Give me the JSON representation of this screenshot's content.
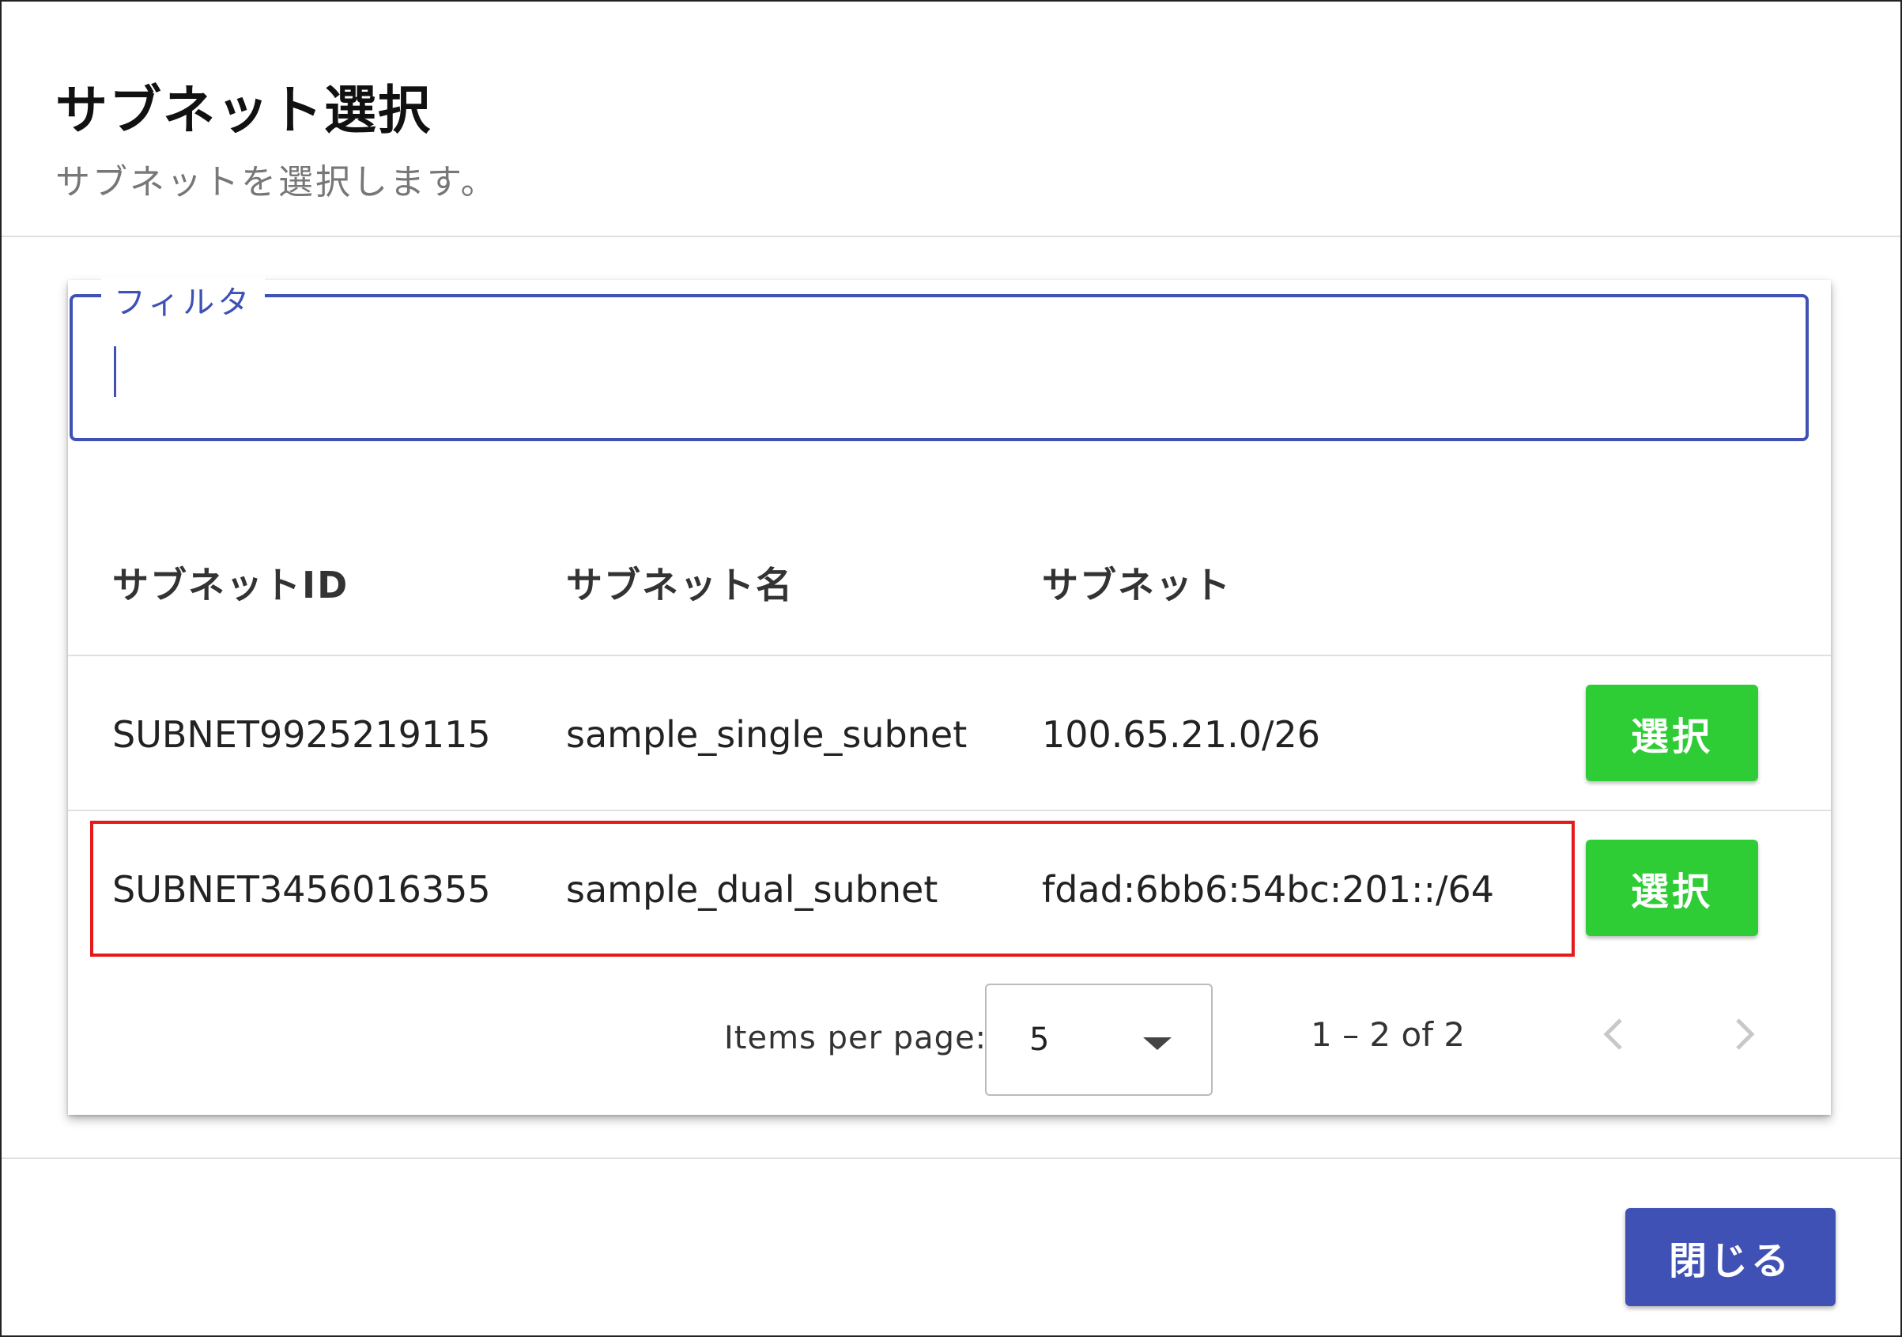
{
  "dialog": {
    "title": "サブネット選択",
    "subtitle": "サブネットを選択します。"
  },
  "filter": {
    "label": "フィルタ",
    "value": "",
    "accent_color": "#3f51b5"
  },
  "table": {
    "headers": [
      "サブネットID",
      "サブネット名",
      "サブネット"
    ],
    "rows": [
      {
        "id": "SUBNET9925219115",
        "name": "sample_single_subnet",
        "subnet": "100.65.21.0/26",
        "action": "選択",
        "highlighted": false
      },
      {
        "id": "SUBNET3456016355",
        "name": "sample_dual_subnet",
        "subnet": "fdad:6bb6:54bc:201::/64",
        "action": "選択",
        "highlighted": true
      }
    ],
    "highlight_color": "#e61919",
    "select_button_color": "#2ecc35"
  },
  "paginator": {
    "items_per_page_label": "Items per page:",
    "items_per_page_value": "5",
    "range_label": "1 – 2 of 2",
    "prev_icon": "chevron-left-icon",
    "next_icon": "chevron-right-icon"
  },
  "footer": {
    "close_label": "閉じる",
    "close_button_color": "#3f51b5"
  }
}
